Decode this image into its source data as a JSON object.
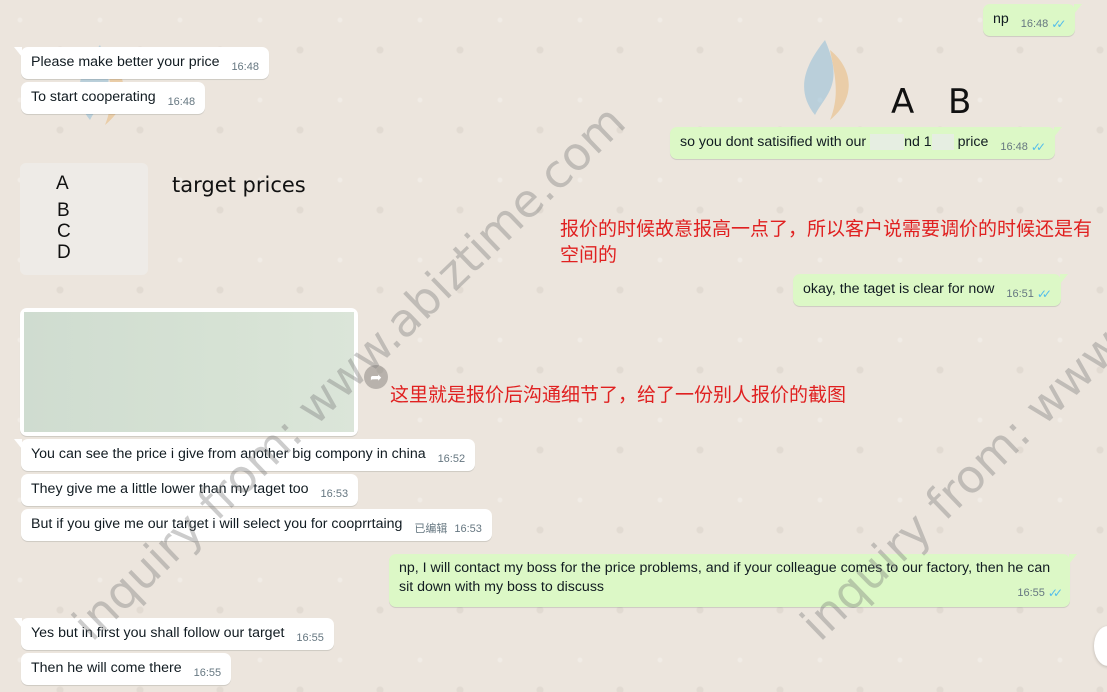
{
  "messages": {
    "np": {
      "text": "np",
      "time": "16:48"
    },
    "better_price": {
      "text": "Please make better your price",
      "time": "16:48"
    },
    "cooperating": {
      "text": "To start cooperating",
      "time": "16:48"
    },
    "satisfied": {
      "pre": "so you dont satisified with our",
      "mid": "nd 1",
      "post": "price",
      "time": "16:48"
    },
    "taget_clear": {
      "text": "okay, the taget is clear for now",
      "time": "16:51"
    },
    "see_price": {
      "text": "You can see the price i give from another big compony in china",
      "time": "16:52"
    },
    "lower": {
      "text": "They give me a little lower than my taget too",
      "time": "16:53"
    },
    "select_you": {
      "text": "But if you give me our target i will select you for cooprrtaing",
      "edited": "已编辑",
      "time": "16:53"
    },
    "contact_boss": {
      "text": "np, I will contact my boss for the price problems, and if your colleague comes to our factory, then he can sit down with my boss to discuss",
      "time": "16:55"
    },
    "follow_target": {
      "text": "Yes but in first you shall follow our target",
      "time": "16:55"
    },
    "come_there": {
      "text": "Then he will come there",
      "time": "16:55"
    }
  },
  "image_card": {
    "letters": [
      "A",
      "B",
      "C",
      "D"
    ],
    "caption": "target prices"
  },
  "overlay": {
    "letter_a": "A",
    "letter_b": "B",
    "annotation_1": "报价的时候故意报高一点了，所以客户说需要调价的时候还是有空间的",
    "annotation_2": "这里就是报价后沟通细节了，给了一份别人报价的截图",
    "watermark": "inquiry from: www.abiztime.com"
  },
  "icons": {
    "forward": "forward-icon",
    "ticks": "double-check-icon"
  },
  "colors": {
    "incoming": "#ffffff",
    "outgoing": "#dcf8c6",
    "annotation": "#e02020",
    "ticks": "#53bdeb"
  }
}
